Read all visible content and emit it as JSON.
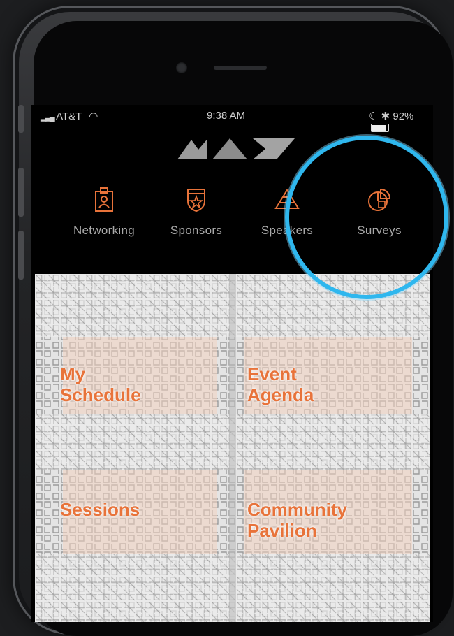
{
  "status_bar": {
    "carrier": "AT&T",
    "time": "9:38 AM",
    "battery": "92%"
  },
  "app": {
    "logo": "MAX"
  },
  "nav": {
    "items": [
      {
        "label": "Networking",
        "icon": "badge-icon"
      },
      {
        "label": "Sponsors",
        "icon": "shield-star-icon"
      },
      {
        "label": "Speakers",
        "icon": "megaphone-icon"
      },
      {
        "label": "Surveys",
        "icon": "pie-chart-icon"
      }
    ]
  },
  "tiles": [
    {
      "label_line1": "My",
      "label_line2": "Schedule"
    },
    {
      "label_line1": "Event",
      "label_line2": "Agenda"
    },
    {
      "label_line1": "Sessions",
      "label_line2": ""
    },
    {
      "label_line1": "Community",
      "label_line2": "Pavilion"
    }
  ],
  "colors": {
    "accent": "#e8733a",
    "highlight": "#2fb7ee",
    "background": "#000000"
  }
}
